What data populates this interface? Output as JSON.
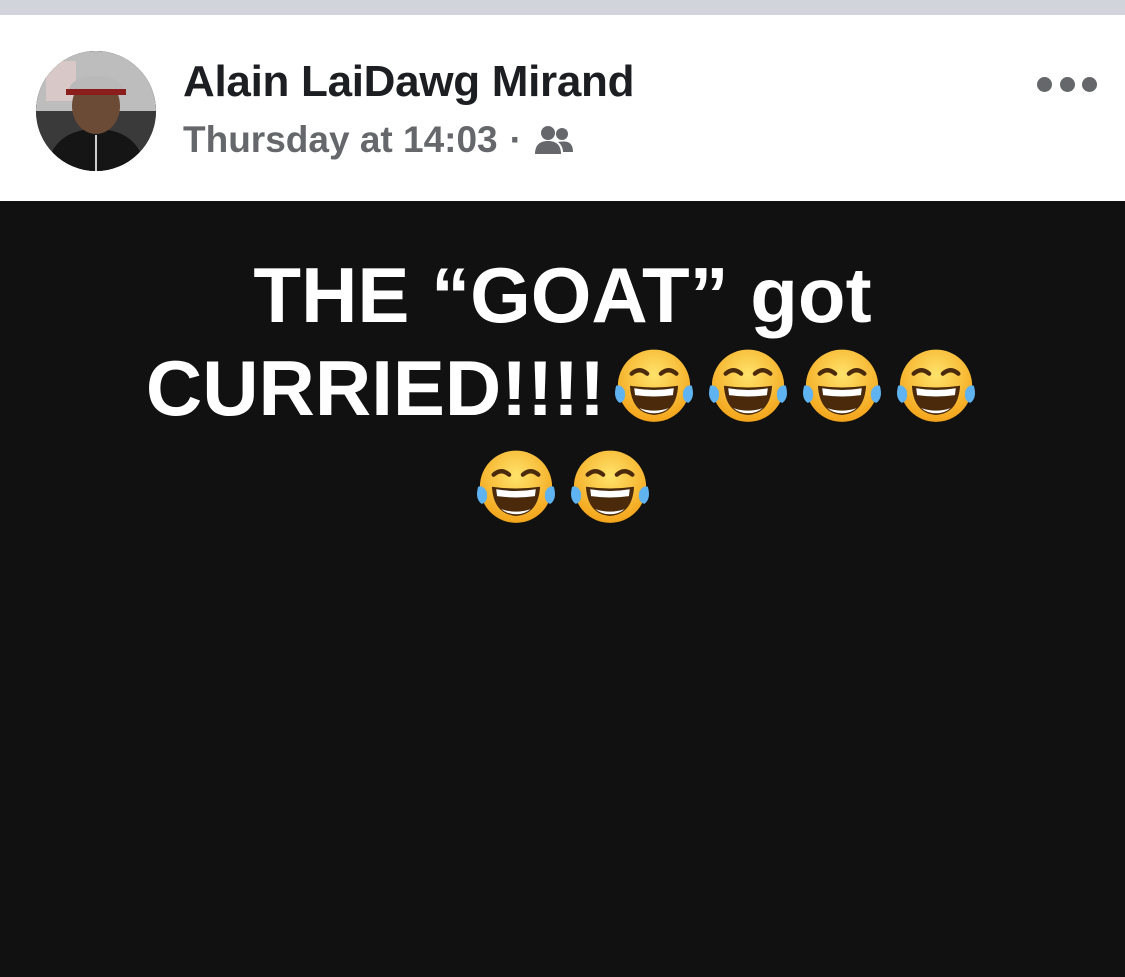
{
  "post": {
    "author_name": "Alain LaiDawg Mirand",
    "timestamp": "Thursday at 14:03",
    "separator": "·",
    "audience_icon": "friends-icon",
    "more_icon": "more-options-icon",
    "text_line1": "THE “GOAT” got",
    "text_line2": "CURRIED!!!!",
    "emoji_name": "face-with-tears-of-joy",
    "emoji_count": 6,
    "colors": {
      "background": "#111111",
      "text": "#ffffff",
      "meta": "#65676b",
      "name": "#1c1e21"
    }
  }
}
